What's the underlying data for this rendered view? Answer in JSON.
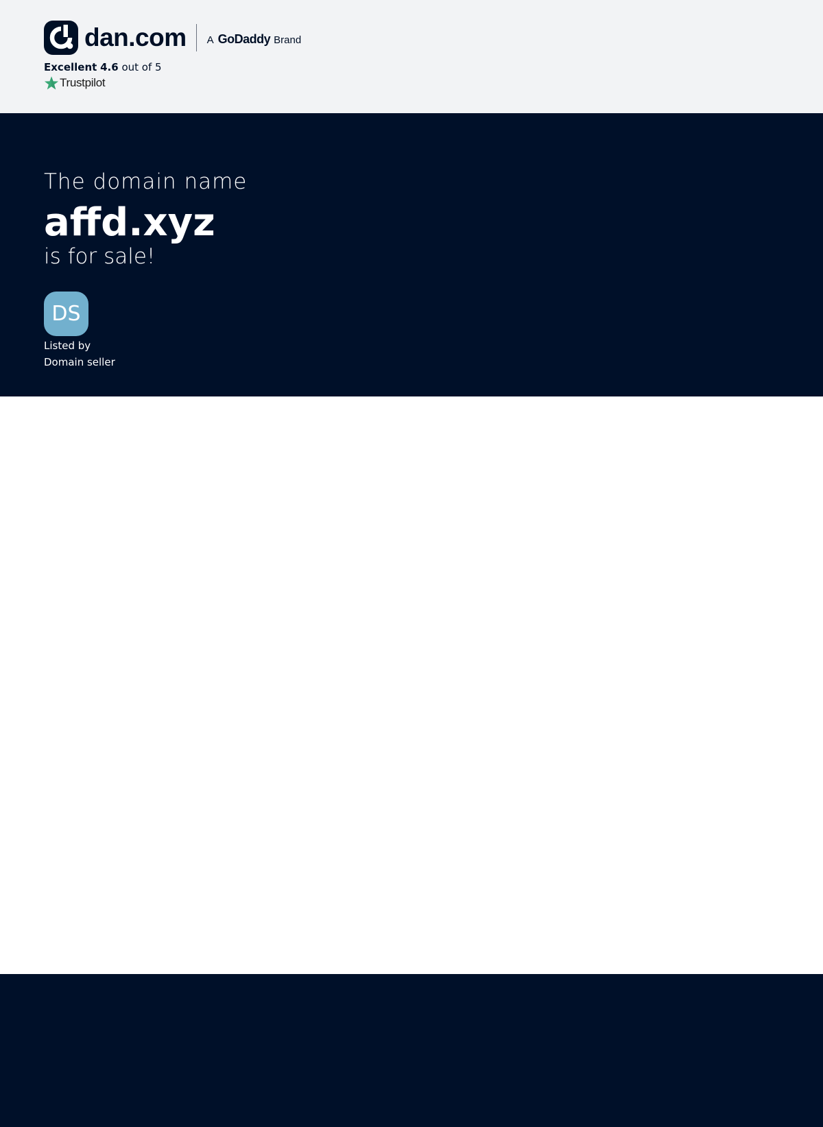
{
  "header": {
    "logo_text": "dan.com",
    "brand_prefix": "A",
    "brand_name": "GoDaddy",
    "brand_suffix": "Brand",
    "rating": {
      "label": "Excellent",
      "score": "4.6",
      "suffix": "out of 5"
    },
    "trustpilot_label": "Trustpilot"
  },
  "hero": {
    "intro": "The domain name",
    "domain": "affd.xyz",
    "sale_text": "is for sale!",
    "avatar_initials": "DS",
    "listed_by_label": "Listed by",
    "seller_name": "Domain seller"
  },
  "colors": {
    "dark_navy": "#001029",
    "header_bg": "#f2f3f5",
    "avatar_bg": "#72b0ce",
    "trustpilot_green": "#00b67a"
  },
  "icons": {
    "logo": "dan-logo-icon",
    "trustpilot": "trustpilot-star-icon"
  }
}
